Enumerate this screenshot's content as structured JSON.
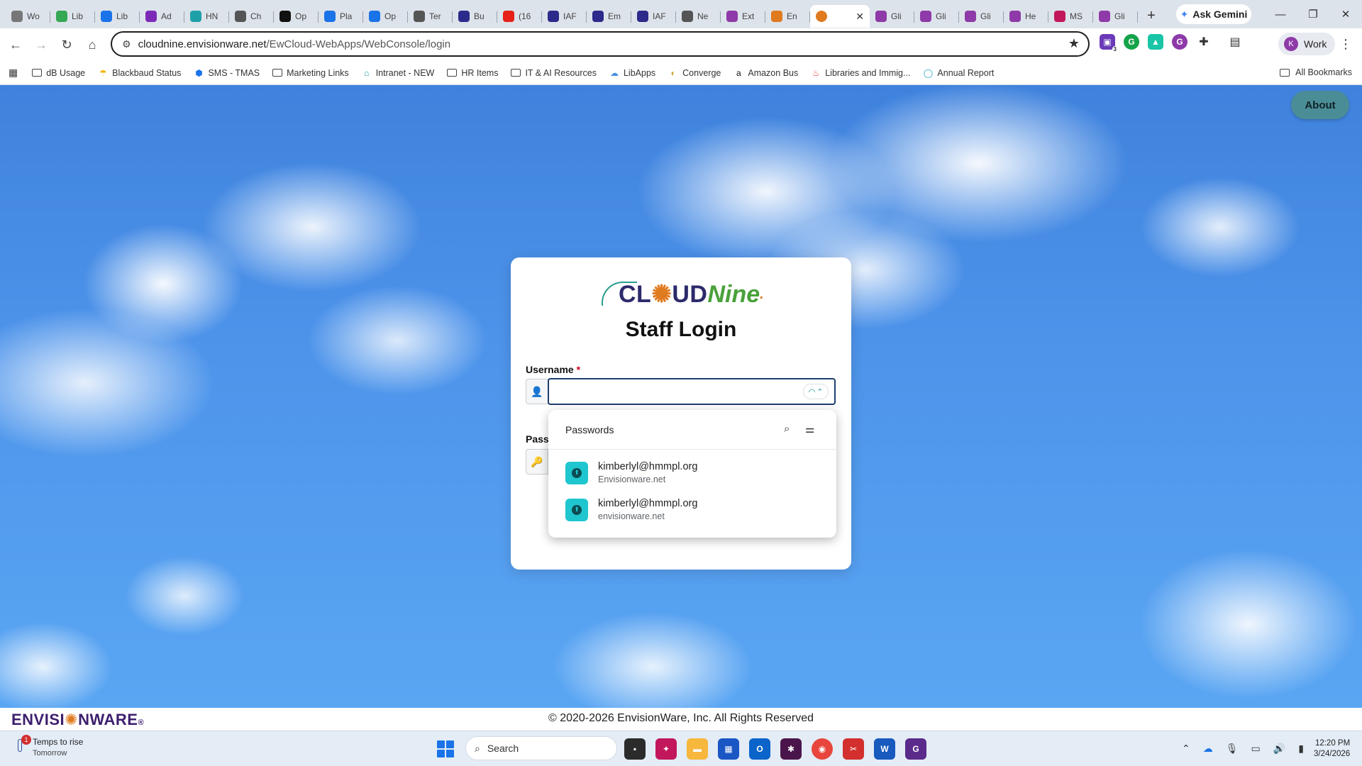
{
  "tabs": [
    {
      "label": "Wo",
      "icon": "clock-icon",
      "color": "#777777"
    },
    {
      "label": "Lib",
      "icon": "sheets-icon",
      "color": "#34a853"
    },
    {
      "label": "Lib",
      "icon": "leaf-icon",
      "color": "#1a73e8"
    },
    {
      "label": "Ad",
      "icon": "target-icon",
      "color": "#7b2ab8"
    },
    {
      "label": "HN",
      "icon": "teal-icon",
      "color": "#1fa0a8"
    },
    {
      "label": "Ch",
      "icon": "openai-icon",
      "color": "#555555"
    },
    {
      "label": "Op",
      "icon": "openai-icon",
      "color": "#111111"
    },
    {
      "label": "Pla",
      "icon": "circle-icon",
      "color": "#1a73e8"
    },
    {
      "label": "Op",
      "icon": "circle-icon",
      "color": "#1a73e8"
    },
    {
      "label": "Ter",
      "icon": "openai-icon",
      "color": "#555555"
    },
    {
      "label": "Bu",
      "icon": "notebook-icon",
      "color": "#2c2a8b"
    },
    {
      "label": "(16",
      "icon": "youtube-icon",
      "color": "#e62117"
    },
    {
      "label": "IAF",
      "icon": "notebook-icon",
      "color": "#2c2a8b"
    },
    {
      "label": "Em",
      "icon": "notebook-icon",
      "color": "#2c2a8b"
    },
    {
      "label": "IAF",
      "icon": "notebook-icon",
      "color": "#2c2a8b"
    },
    {
      "label": "Ne",
      "icon": "openai-icon",
      "color": "#555555"
    },
    {
      "label": "Ext",
      "icon": "g-icon",
      "color": "#8e3aa8"
    },
    {
      "label": "En",
      "icon": "pinwheel-icon",
      "color": "#e07a1f"
    },
    {
      "label": "Gli",
      "icon": "g-icon",
      "color": "#8e3aa8"
    },
    {
      "label": "Gli",
      "icon": "g-icon",
      "color": "#8e3aa8"
    },
    {
      "label": "Gli",
      "icon": "g-icon",
      "color": "#8e3aa8"
    },
    {
      "label": "He",
      "icon": "g-icon",
      "color": "#8e3aa8"
    },
    {
      "label": "MS",
      "icon": "butterfly-icon",
      "color": "#c2185b"
    },
    {
      "label": "Gli",
      "icon": "g-icon",
      "color": "#8e3aa8"
    }
  ],
  "active_tab_icon": "pinwheel-icon",
  "active_tab_close": "✕",
  "new_tab": "+",
  "gemini_label": "Ask Gemini",
  "window_controls": {
    "minimize": "—",
    "restore": "❐",
    "close": "✕"
  },
  "toolbar": {
    "url_host": "cloudnine.envisionware.net",
    "url_path": "/EwCloud-WebApps/WebConsole/login",
    "profile_label": "Work",
    "profile_initial": "K",
    "extension_badge": "3"
  },
  "bookmarks": [
    {
      "label": "dB Usage",
      "icon": "folder"
    },
    {
      "label": "Blackbaud Status",
      "icon": "blackbaud"
    },
    {
      "label": "SMS - TMAS",
      "icon": "cube"
    },
    {
      "label": "Marketing Links",
      "icon": "folder"
    },
    {
      "label": "Intranet - NEW",
      "icon": "intranet"
    },
    {
      "label": "HR Items",
      "icon": "folder"
    },
    {
      "label": "IT & AI Resources",
      "icon": "folder"
    },
    {
      "label": "LibApps",
      "icon": "cloud"
    },
    {
      "label": "Converge",
      "icon": "converge"
    },
    {
      "label": "Amazon Bus",
      "icon": "amazon"
    },
    {
      "label": "Libraries and Immig...",
      "icon": "flame"
    },
    {
      "label": "Annual Report",
      "icon": "ring"
    }
  ],
  "all_bookmarks": "All Bookmarks",
  "about_button": "About",
  "login": {
    "logo_cl": "CL",
    "logo_oo": "✺",
    "logo_ud": "UD",
    "logo_nine": "Nine",
    "logo_dot": ".",
    "title": "Staff Login",
    "username_label": "Username",
    "required_mark": "*",
    "username_value": "",
    "password_label": "Pass"
  },
  "passwords_popup": {
    "title": "Passwords",
    "entries": [
      {
        "username": "kimberlyl@hmmpl.org",
        "site": "Envisionware.net"
      },
      {
        "username": "kimberlyl@hmmpl.org",
        "site": "envisionware.net"
      }
    ]
  },
  "footer": {
    "brand_a": "ENVISI",
    "brand_o": "✺",
    "brand_b": "NWARE",
    "brand_reg": "®",
    "copyright": "© 2020-2026 EnvisionWare, Inc. All Rights Reserved"
  },
  "taskbar": {
    "weather_title": "Temps to rise",
    "weather_sub": "Tomorrow",
    "weather_badge": "1",
    "search_label": "Search",
    "time": "12:20 PM",
    "date": "3/24/2026"
  }
}
